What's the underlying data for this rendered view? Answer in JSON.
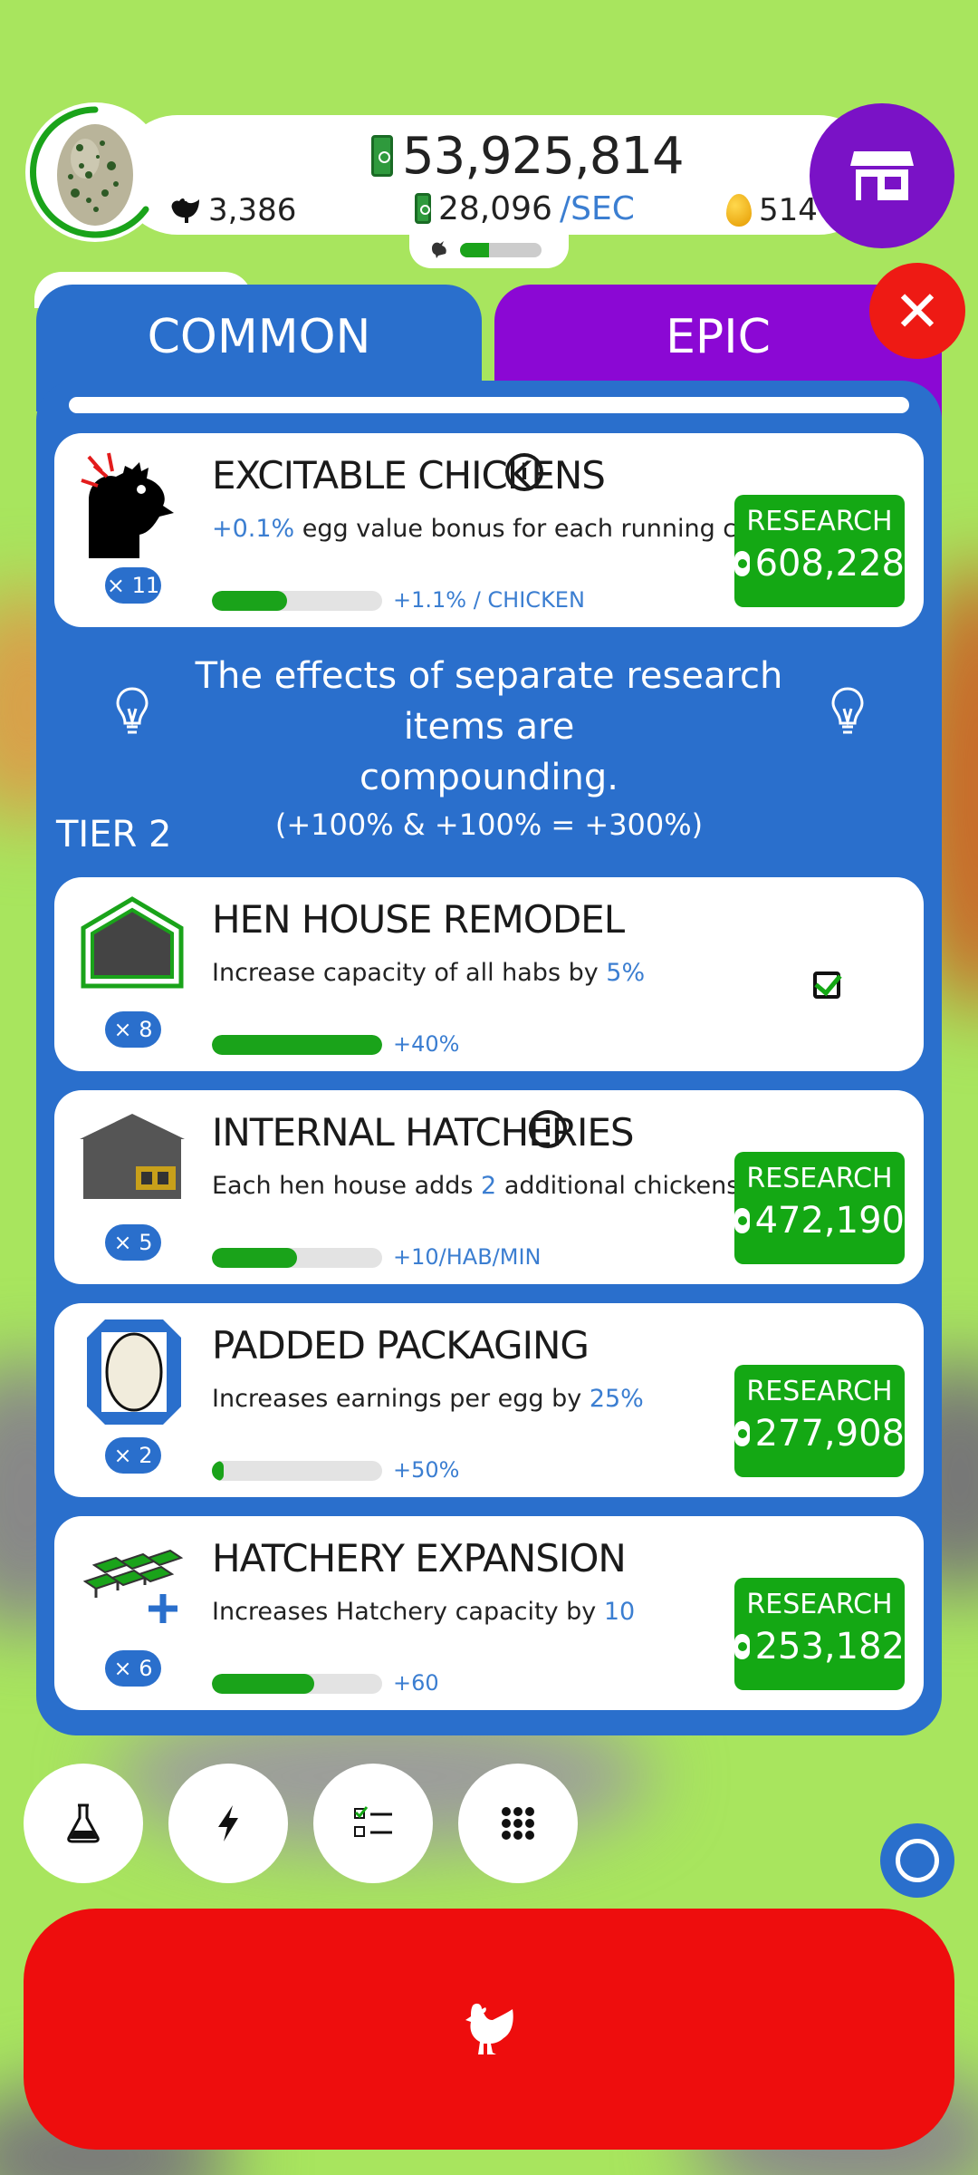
{
  "header": {
    "money": "53,925,814",
    "chicken_count": "3,386",
    "rate_value": "28,096",
    "rate_unit": "/SEC",
    "golden_eggs": "514",
    "progress_fraction": 0.35
  },
  "tabs": [
    {
      "label": "COMMON",
      "active": true
    },
    {
      "label": "EPIC",
      "active": false
    }
  ],
  "tier1_items": [
    {
      "title": "EXCITABLE CHICKENS",
      "desc_highlight_prefix": "+0.1%",
      "desc_text": " egg value bonus for each running chicken",
      "level": "× 11",
      "progress": 0.44,
      "bonus": "+1.1% / CHICKEN",
      "research_label": "RESEARCH",
      "cost": "608,228"
    }
  ],
  "tip": {
    "line1": "The effects of separate research items are",
    "line2": "compounding.",
    "line3": "(+100% & +100% = +300%)"
  },
  "tier_label": "TIER 2",
  "tier2_items": [
    {
      "title": "HEN HOUSE REMODEL",
      "desc_pre": "Increase capacity of all habs by ",
      "desc_hl": "5%",
      "desc_post": "",
      "level": "× 8",
      "progress": 1.0,
      "bonus": "+40%",
      "completed": true
    },
    {
      "title": "INTERNAL HATCHERIES",
      "desc_pre": "Each hen house adds ",
      "desc_hl": "2",
      "desc_post": " additional chickens per minute",
      "level": "× 5",
      "progress": 0.5,
      "bonus": "+10/HAB/MIN",
      "research_label": "RESEARCH",
      "cost": "472,190"
    },
    {
      "title": "PADDED PACKAGING",
      "desc_pre": "Increases earnings per egg by ",
      "desc_hl": "25%",
      "desc_post": "",
      "level": "× 2",
      "progress": 0.07,
      "bonus": "+50%",
      "research_label": "RESEARCH",
      "cost": "277,908"
    },
    {
      "title": "HATCHERY EXPANSION",
      "desc_pre": "Increases Hatchery capacity by ",
      "desc_hl": "10",
      "desc_post": "",
      "level": "× 6",
      "progress": 0.6,
      "bonus": "+60",
      "research_label": "RESEARCH",
      "cost": "253,182"
    }
  ],
  "bottom_buttons": [
    "flask-icon",
    "bolt-icon",
    "checklist-icon",
    "grid-icon"
  ],
  "colors": {
    "background": "#a8e55e",
    "panel_blue": "#2a6fcc",
    "epic_purple": "#8b08d4",
    "research_green": "#14a814",
    "close_red": "#ee1a14",
    "hatch_red": "#ee0d0d"
  }
}
